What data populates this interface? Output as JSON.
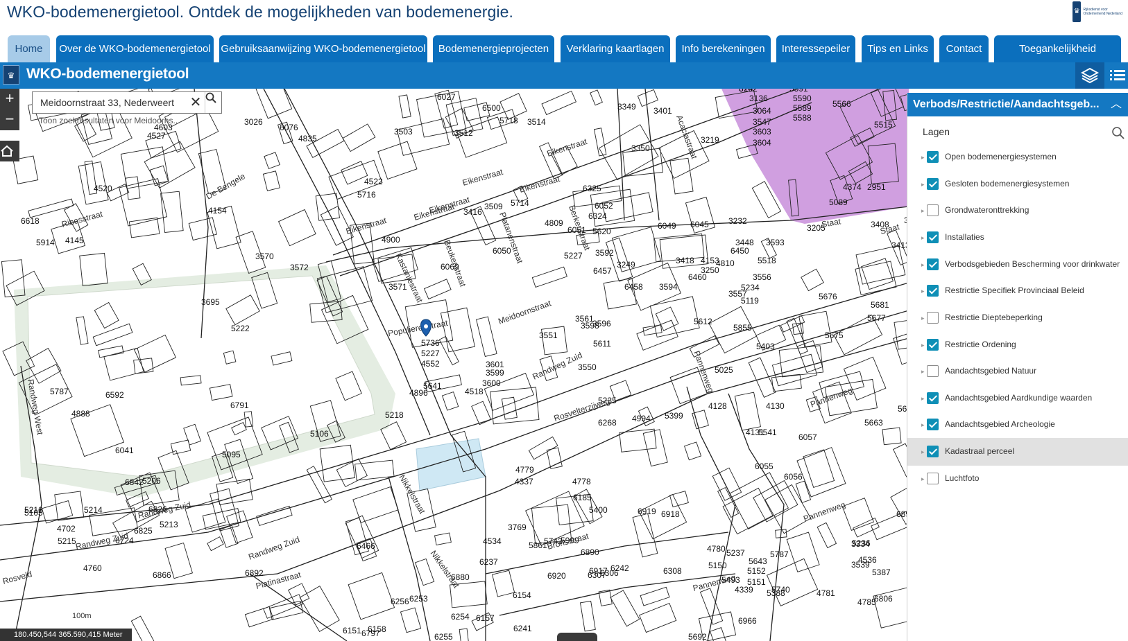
{
  "site": {
    "title": "WKO-bodemenergietool. Ontdek de mogelijkheden van bodemenergie.",
    "logo_text": "Rijksdienst voor Ondernemend Nederland"
  },
  "nav": {
    "tabs": [
      {
        "label": "Home",
        "active": true
      },
      {
        "label": "Over de WKO-bodemenergietool",
        "active": false
      },
      {
        "label": "Gebruiksaanwijzing WKO-bodemenergietool",
        "active": false
      },
      {
        "label": "Bodemenergieprojecten",
        "active": false
      },
      {
        "label": "Verklaring kaartlagen",
        "active": false
      },
      {
        "label": "Info berekeningen",
        "active": false
      },
      {
        "label": "Interessepeiler",
        "active": false
      },
      {
        "label": "Tips en Links",
        "active": false
      },
      {
        "label": "Contact",
        "active": false
      },
      {
        "label": "Toegankelijkheid",
        "active": false
      }
    ]
  },
  "app": {
    "title": "WKO-bodemenergietool",
    "layers_icon": "layers-icon",
    "list_icon": "list-icon"
  },
  "search": {
    "value": "Meidoornstraat 33, Nederweert",
    "hint": "Toon zoekresultaten voor Meidoorns..."
  },
  "map": {
    "scale_label": "100m",
    "coordinates": "180.450,544 365.590,415 Meter",
    "parcels": [
      "3162",
      "5591",
      "5590",
      "5589",
      "5588",
      "3136",
      "3064",
      "3547",
      "3603",
      "3604",
      "5089",
      "4374",
      "2951",
      "5566",
      "5515",
      "3219",
      "3350",
      "3401",
      "3349",
      "3514",
      "5718",
      "6500",
      "3512",
      "3503",
      "6027",
      "3026",
      "6076",
      "4835",
      "4603",
      "4527",
      "4520",
      "4522",
      "5716",
      "5714",
      "3509",
      "3416",
      "4809",
      "6052",
      "6325",
      "6324",
      "5620",
      "6051",
      "6045",
      "6049",
      "3232",
      "3205",
      "3408",
      "3317",
      "3413",
      "4900",
      "6069",
      "6050",
      "5227",
      "3418",
      "4153",
      "4810",
      "5518",
      "3448",
      "3593",
      "6450",
      "6460",
      "3250",
      "3249",
      "3592",
      "6457",
      "6458",
      "3594",
      "3571",
      "3570",
      "3572",
      "3695",
      "5222",
      "4154",
      "5914",
      "4145",
      "6618",
      "5736",
      "5227",
      "4552",
      "5641",
      "4896",
      "4518",
      "3599",
      "3600",
      "3601",
      "3550",
      "3551",
      "3561",
      "3596",
      "3598",
      "5611",
      "5612",
      "5119",
      "3557",
      "3556",
      "5403",
      "5855",
      "5234",
      "5025",
      "4128",
      "4130",
      "5675",
      "5676",
      "5677",
      "5681",
      "5235",
      "6268",
      "4994",
      "5399",
      "4131",
      "5541",
      "6055",
      "6056",
      "6057",
      "5663",
      "5644",
      "4779",
      "4337",
      "4778",
      "6185",
      "5400",
      "4534",
      "3769",
      "5861",
      "5999",
      "5742",
      "6890",
      "6917",
      "6919",
      "6918",
      "6920",
      "6880",
      "6154",
      "6237",
      "6466",
      "6892",
      "6866",
      "6842",
      "6825",
      "6826",
      "5213",
      "5214",
      "5215",
      "5216",
      "5105",
      "4702",
      "6724",
      "6041",
      "4888",
      "5206",
      "5095",
      "5106",
      "5218",
      "6791",
      "5787",
      "6592",
      "4760",
      "6894",
      "6256",
      "6253",
      "6254",
      "6157",
      "6158",
      "6843",
      "6797",
      "6151",
      "6255",
      "6241",
      "6242",
      "6306",
      "6307",
      "6308",
      "5643",
      "5151",
      "5152",
      "5237",
      "5150",
      "4780",
      "5787",
      "5236",
      "4536",
      "3334",
      "3539",
      "4339",
      "5388",
      "5493",
      "6966",
      "5740",
      "4781",
      "5692",
      "5387",
      "4785",
      "6806",
      "6242"
    ],
    "streets": [
      "Eikenstraat",
      "Eikenstraat",
      "Eikenstraat",
      "Eikenstraat",
      "Eikenstraat",
      "Kastanjestraat",
      "Beukenstraat",
      "Platanenstraat",
      "Berkenstraat",
      "Acaciastraat",
      "Ribesstraat",
      "Eikenstraat",
      "De Bengele",
      "Randweg West",
      "Randweg Zuid",
      "Randweg Zuid",
      "Randweg Zuid",
      "Randweg Zuid",
      "Nikkelstraat",
      "Nikkelstraat",
      "Rosvelterzijweg",
      "Pannenweg",
      "Pannenweg",
      "Pannenweg",
      "Pannenweg",
      "Bronsstraat",
      "Platinastraat",
      "Rosveld",
      "Staat",
      "Staat",
      "Populierenstraat",
      "Meidoornstraat"
    ]
  },
  "panel": {
    "title": "Verbods/Restrictie/Aandachtsgeb...",
    "subtitle": "Lagen",
    "layers": [
      {
        "label": "Open bodemenergiesystemen",
        "checked": true,
        "highlighted": false
      },
      {
        "label": "Gesloten bodemenergiesystemen",
        "checked": true,
        "highlighted": false
      },
      {
        "label": "Grondwateronttrekking",
        "checked": false,
        "highlighted": false
      },
      {
        "label": "Installaties",
        "checked": true,
        "highlighted": false
      },
      {
        "label": "Verbodsgebieden Bescherming voor drinkwater",
        "checked": true,
        "highlighted": false
      },
      {
        "label": "Restrictie Specifiek Provinciaal Beleid",
        "checked": true,
        "highlighted": false
      },
      {
        "label": "Restrictie Dieptebeperking",
        "checked": false,
        "highlighted": false
      },
      {
        "label": "Restrictie Ordening",
        "checked": true,
        "highlighted": false
      },
      {
        "label": "Aandachtsgebied Natuur",
        "checked": false,
        "highlighted": false
      },
      {
        "label": "Aandachtsgebied Aardkundige waarden",
        "checked": true,
        "highlighted": false
      },
      {
        "label": "Aandachtsgebied Archeologie",
        "checked": true,
        "highlighted": false
      },
      {
        "label": "Kadastraal perceel",
        "checked": true,
        "highlighted": true
      },
      {
        "label": "Luchtfoto",
        "checked": false,
        "highlighted": false
      }
    ]
  },
  "colors": {
    "header_text": "#154273",
    "tab_bg": "#0b6fbd",
    "tab_active_bg": "#a7cbe8",
    "appbar_bg": "#1478c2",
    "check_on": "#0f8fb6",
    "purple_zone": "#c07fd6",
    "green_zone": "#d9e6d5"
  }
}
